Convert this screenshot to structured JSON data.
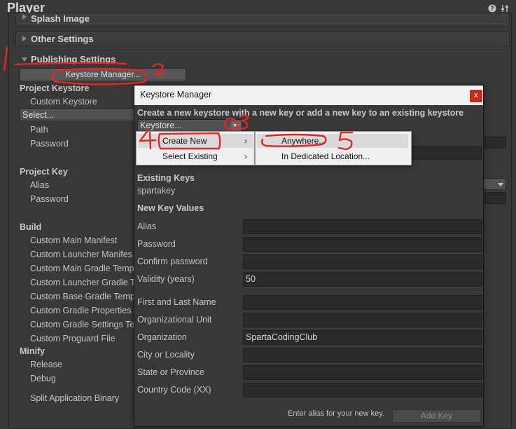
{
  "window": {
    "title": "Player"
  },
  "sections": {
    "splash": "Splash Image",
    "other": "Other Settings",
    "publishing": "Publishing Settings"
  },
  "left": {
    "keystore_manager_btn": "Keystore Manager...",
    "project_keystore": "Project Keystore",
    "custom_keystore": "Custom Keystore",
    "select_dropdown": "Select...",
    "path": "Path",
    "password": "Password",
    "project_key": "Project Key",
    "alias": "Alias",
    "key_password": "Password",
    "build": "Build",
    "build_items": [
      "Custom Main Manifest",
      "Custom Launcher Manifes",
      "Custom Main Gradle Temp",
      "Custom Launcher Gradle T",
      "Custom Base Gradle Temp",
      "Custom Gradle Properties",
      "Custom Gradle Settings Te",
      "Custom Proguard File"
    ],
    "minify": "Minify",
    "release": "Release",
    "debug": "Debug",
    "split_binary": "Split Application Binary"
  },
  "dialog": {
    "title": "Keystore Manager",
    "close": "x",
    "instructions": "Create a new keystore with a new key or add a new key to an existing keystore",
    "keystore_dropdown": "Keystore...",
    "existing_keys_label": "Existing Keys",
    "existing_key": "spartakey",
    "new_key_values": "New Key Values",
    "fields": [
      {
        "label": "Alias",
        "value": ""
      },
      {
        "label": "Password",
        "value": ""
      },
      {
        "label": "Confirm password",
        "value": ""
      },
      {
        "label": "Validity (years)",
        "value": "50"
      },
      {
        "label": "First and Last Name",
        "value": ""
      },
      {
        "label": "Organizational Unit",
        "value": ""
      },
      {
        "label": "Organization",
        "value": "SpartaCodingClub"
      },
      {
        "label": "City or Locality",
        "value": ""
      },
      {
        "label": "State or Province",
        "value": ""
      },
      {
        "label": "Country Code (XX)",
        "value": ""
      }
    ],
    "hint": "Enter alias for your new key.",
    "add_key": "Add Key"
  },
  "menu": {
    "create_new": "Create New",
    "select_existing": "Select Existing",
    "anywhere": "Anywhere...",
    "dedicated": "In Dedicated Location..."
  },
  "annotations": {
    "n1": "1",
    "n2": "2",
    "n3": "3",
    "n4": "4",
    "n5": "5"
  }
}
